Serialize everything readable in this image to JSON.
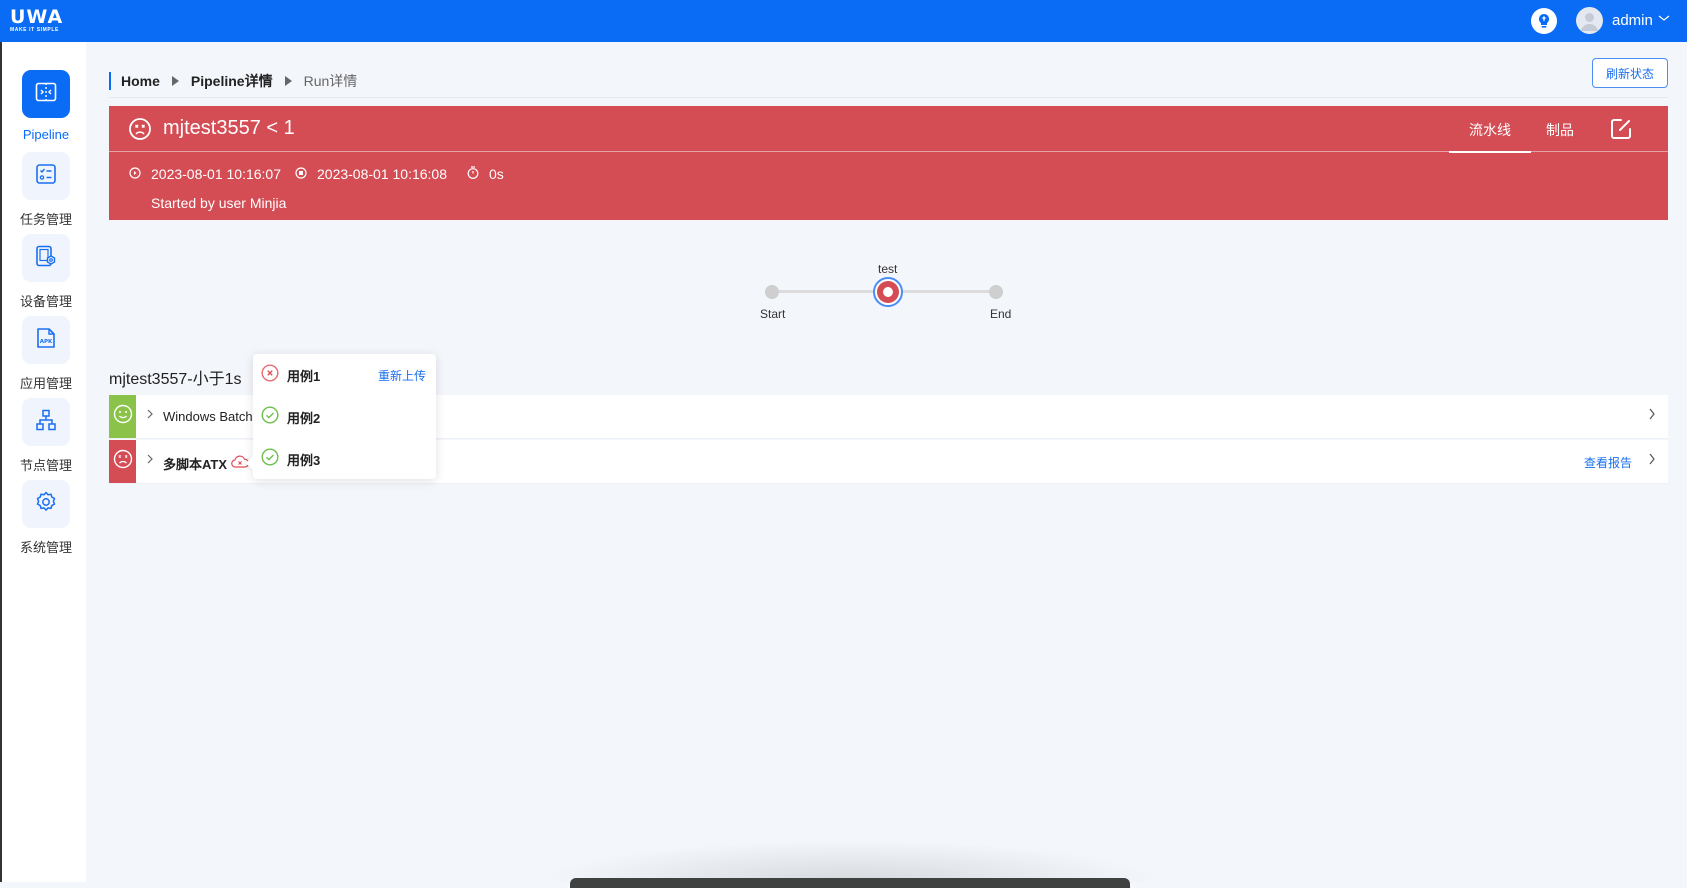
{
  "topbar": {
    "logo_text": "UWA",
    "logo_tagline": "MAKE IT SIMPLE",
    "user_name": "admin"
  },
  "sidebar": {
    "items": [
      {
        "label": "Pipeline",
        "icon": "pipeline-icon",
        "active": true
      },
      {
        "label": "任务管理",
        "icon": "task-list-icon",
        "active": false
      },
      {
        "label": "设备管理",
        "icon": "device-settings-icon",
        "active": false
      },
      {
        "label": "应用管理",
        "icon": "apk-file-icon",
        "active": false
      },
      {
        "label": "节点管理",
        "icon": "node-tree-icon",
        "active": false
      },
      {
        "label": "系统管理",
        "icon": "gear-icon",
        "active": false
      }
    ]
  },
  "breadcrumb": {
    "items": [
      "Home",
      "Pipeline详情",
      "Run详情"
    ]
  },
  "refresh_button": "刷新状态",
  "run": {
    "title": "mjtest3557 < 1",
    "status": "failed",
    "tabs": [
      {
        "label": "流水线",
        "active": true
      },
      {
        "label": "制品",
        "active": false
      }
    ],
    "start_time": "2023-08-01 10:16:07",
    "end_time": "2023-08-01 10:16:08",
    "duration": "0s",
    "started_by": "Started by user Minjia"
  },
  "pipeline_graph": {
    "nodes": [
      {
        "label": "Start",
        "state": "idle"
      },
      {
        "label": "test",
        "state": "failed"
      },
      {
        "label": "End",
        "state": "idle"
      }
    ]
  },
  "stage_section": {
    "title": "mjtest3557-小于1s",
    "jobs": [
      {
        "name": "Windows Batch",
        "status": "success",
        "report_link": null
      },
      {
        "name": "多脚本ATX",
        "status": "failed",
        "report_link": "查看报告"
      }
    ]
  },
  "cases_popup": {
    "cases": [
      {
        "name": "用例1",
        "status": "failed",
        "action": "重新上传"
      },
      {
        "name": "用例2",
        "status": "passed",
        "action": null
      },
      {
        "name": "用例3",
        "status": "passed",
        "action": null
      }
    ]
  },
  "colors": {
    "brand": "#0a6cf5",
    "failed": "#d44c54",
    "success": "#8bc34a",
    "link": "#1a6ff0"
  }
}
